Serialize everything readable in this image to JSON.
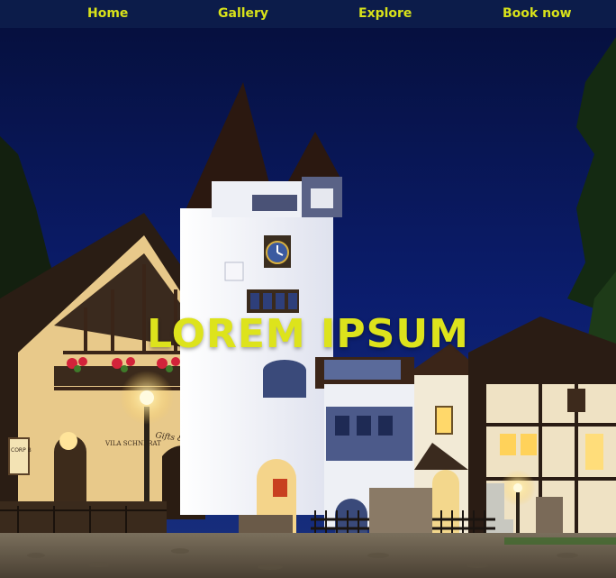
{
  "nav": {
    "items": [
      {
        "label": "Home"
      },
      {
        "label": "Gallery"
      },
      {
        "label": "Explore"
      },
      {
        "label": "Book now"
      }
    ]
  },
  "hero": {
    "headline": "LOREM IPSUM",
    "sign_souvenirs": "Gifts & Souvenirs",
    "sign_vila": "VILA SCHNERAT",
    "sign_corp": "CORP B"
  },
  "colors": {
    "nav_bg": "#0c1c4a",
    "nav_text": "#d8e21a",
    "headline": "#dde31c",
    "sky": "#0a1a5c"
  }
}
